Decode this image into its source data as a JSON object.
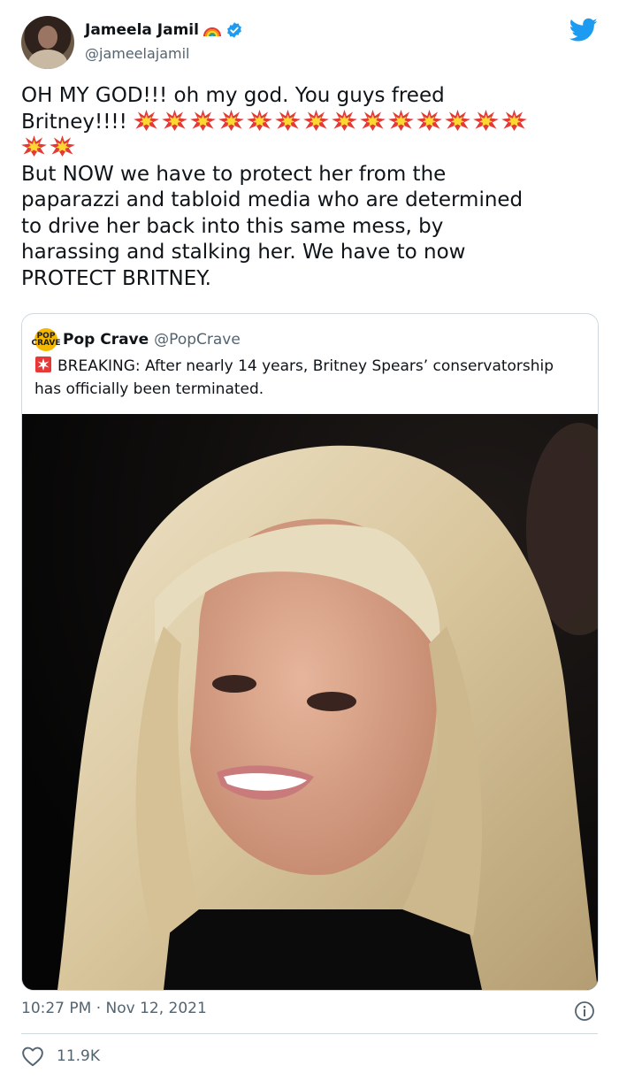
{
  "author": {
    "name": "Jameela Jamil",
    "handle": "@jameelajamil"
  },
  "tweet": {
    "line1": "OH MY GOD!!! oh my god. You guys freed",
    "line2_prefix": "Britney!!!! ",
    "body": "But NOW we have to protect her from the\npaparazzi and tabloid media who are determined\nto drive her back into this same mess, by\nharassing and stalking her. We have to now\nPROTECT BRITNEY.",
    "emoji_icon": "collision-icon",
    "emoji_count_line2": 14,
    "emoji_count_line3": 2
  },
  "quoted": {
    "name": "Pop Crave",
    "handle": "@PopCrave",
    "logo_text": "POP CRAVE",
    "text": "BREAKING: After nearly 14 years, Britney Spears’ conservatorship has officially been terminated."
  },
  "meta": {
    "time": "10:27 PM · Nov 12, 2021",
    "likes": "11.9K"
  },
  "colors": {
    "twitter_blue": "#1d9bf0",
    "text": "#0f1419",
    "secondary": "#536471",
    "border": "#cfd9de",
    "pop_crave_yellow": "#f5b800"
  }
}
